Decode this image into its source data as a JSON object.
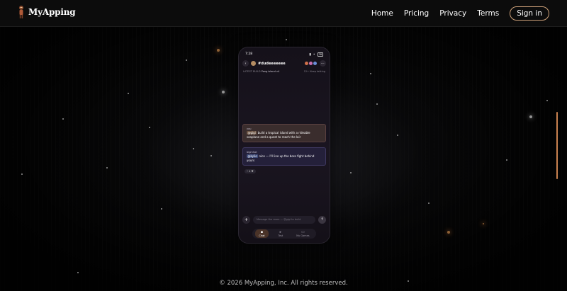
{
  "brand": {
    "name": "MyApping"
  },
  "nav": {
    "home": "Home",
    "pricing": "Pricing",
    "privacy": "Privacy",
    "terms": "Terms",
    "signin": "Sign in"
  },
  "phone": {
    "time": "7:28",
    "battery": "76",
    "room": "#dudeeeeeee",
    "sub_left_label": "LATEST BUILD",
    "sub_left_value": "Pong island v4",
    "sub_right": "12+ Keep talking",
    "msg1": {
      "author": "you",
      "mention": "@gigi",
      "text": " build a tropical island with a rideable seaplane and a quest to reach the lair"
    },
    "msg2": {
      "author": "bigmhat",
      "mention": "@kylie",
      "text": " nice — I'll line up the boss fight behind yours"
    },
    "reaction": "• 4 ♥",
    "input_placeholder": "Message the room — @gigi to build",
    "tabs": [
      {
        "icon": "chat-icon",
        "label": "Chat"
      },
      {
        "icon": "play-icon",
        "label": "Test"
      },
      {
        "icon": "gamepad-icon",
        "label": "My Games"
      }
    ]
  },
  "footer": {
    "text": "© 2026 MyApping, Inc. All rights reserved."
  },
  "colors": {
    "accent": "#cfa27a",
    "scrollbar": "#c9814f",
    "background": "#060606"
  }
}
